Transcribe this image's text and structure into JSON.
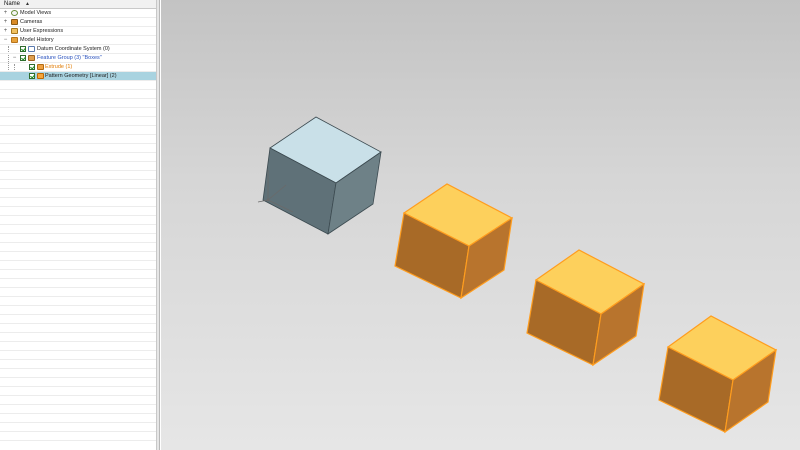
{
  "navigator": {
    "column_header": "Name",
    "rows": [
      {
        "label": "Model Views",
        "icon": "model-views-icon"
      },
      {
        "label": "Cameras",
        "icon": "camera-icon"
      },
      {
        "label": "User Expressions",
        "icon": "expression-icon"
      },
      {
        "label": "Model History",
        "icon": "folder-icon"
      },
      {
        "label": "Datum Coordinate System (0)",
        "icon": "datum-csys-icon"
      },
      {
        "label": "Feature Group (3) \"Boxes\"",
        "icon": "feature-group-icon"
      },
      {
        "label": "Extrude (1)",
        "icon": "extrude-icon"
      },
      {
        "label": "Pattern Geometry [Linear] (2)",
        "icon": "pattern-geometry-icon",
        "selected": true
      }
    ]
  },
  "viewport": {
    "colors": {
      "gray_box_top": "#c9e0e8",
      "gray_box_left": "#5f7178",
      "gray_box_right": "#6e8187",
      "orange_box_top": "#fdd05c",
      "orange_box_left": "#a86a27",
      "orange_box_right": "#b8742d",
      "orange_edge": "#ff9d1e",
      "background_top": "#c3c3c3",
      "background_bottom": "#e6e6e6"
    },
    "objects": [
      {
        "name": "source-box",
        "type": "extrude",
        "highlighted": false
      },
      {
        "name": "pattern-box-1",
        "type": "pattern-instance",
        "highlighted": true
      },
      {
        "name": "pattern-box-2",
        "type": "pattern-instance",
        "highlighted": true
      },
      {
        "name": "pattern-box-3",
        "type": "pattern-instance",
        "highlighted": true
      }
    ]
  }
}
